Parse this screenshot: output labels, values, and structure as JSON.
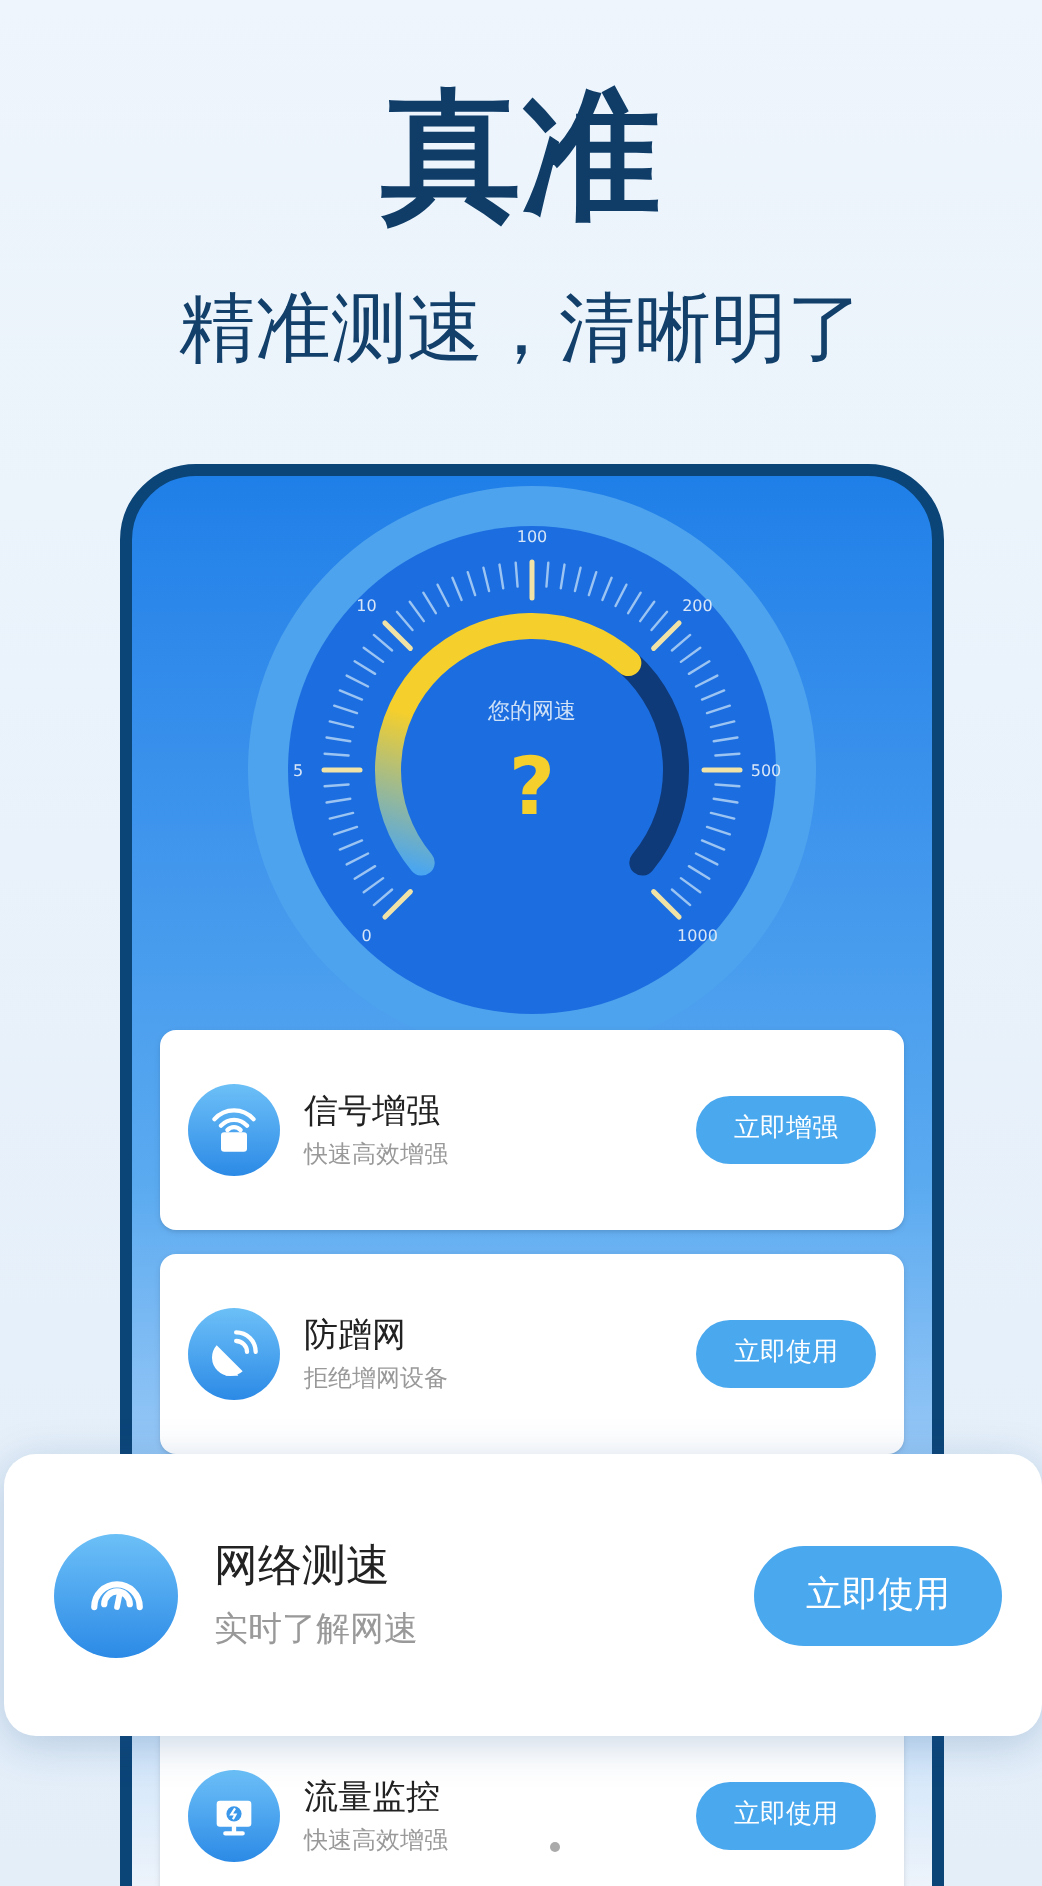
{
  "headline": {
    "title": "真准",
    "subtitle": "精准测速，清晰明了"
  },
  "gauge": {
    "label": "您的网速",
    "value": "?",
    "ticks": [
      "0",
      "5",
      "10",
      "100",
      "200",
      "500",
      "1000"
    ]
  },
  "features": [
    {
      "kind": "card",
      "title": "信号增强",
      "subtitle": "快速高效增强",
      "button": "立即增强"
    },
    {
      "kind": "card",
      "title": "防蹭网",
      "subtitle": "拒绝增网设备",
      "button": "立即使用"
    },
    {
      "kind": "popout",
      "title": "网络测速",
      "subtitle": "实时了解网速",
      "button": "立即使用"
    },
    {
      "kind": "card",
      "title": "流量监控",
      "subtitle": "快速高效增强",
      "button": "立即使用"
    }
  ]
}
